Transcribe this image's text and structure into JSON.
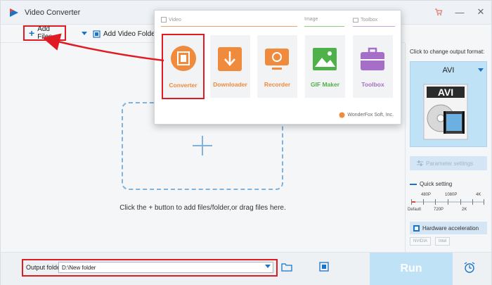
{
  "window": {
    "title": "Video Converter"
  },
  "toolbar": {
    "add_files": "Add Files",
    "add_video_folder": "Add Video Folder"
  },
  "main": {
    "hint": "Click the + button to add files/folder,or drag files here."
  },
  "bottom": {
    "output_label": "Output folder:",
    "output_value": "D:\\New folder",
    "run": "Run"
  },
  "right_panel": {
    "caption": "Click to change output format:",
    "format": "AVI",
    "format_badge": "AVI",
    "parameter_settings": "Parameter settings",
    "quick_setting": "Quick setting",
    "top_labels": [
      "480P",
      "1080P",
      "4K"
    ],
    "bottom_labels": [
      "Default",
      "720P",
      "2K"
    ],
    "hardware_acceleration": "Hardware acceleration",
    "gpu": [
      "NVIDIA",
      "Intel"
    ]
  },
  "popup": {
    "categories": {
      "video": "Video",
      "image": "Image",
      "toolbox": "Toolbox"
    },
    "tiles": [
      {
        "label": "Converter",
        "color": "#f08a3c"
      },
      {
        "label": "Downloader",
        "color": "#f08a3c"
      },
      {
        "label": "Recorder",
        "color": "#f08a3c"
      },
      {
        "label": "GIF Maker",
        "color": "#4fb14a"
      },
      {
        "label": "Toolbox",
        "color": "#a56ec7"
      }
    ],
    "brand": "WonderFox Soft, Inc."
  },
  "colors": {
    "accent": "#1a73c9",
    "highlight": "#e01b24",
    "run_bg": "#bfe2f7"
  }
}
